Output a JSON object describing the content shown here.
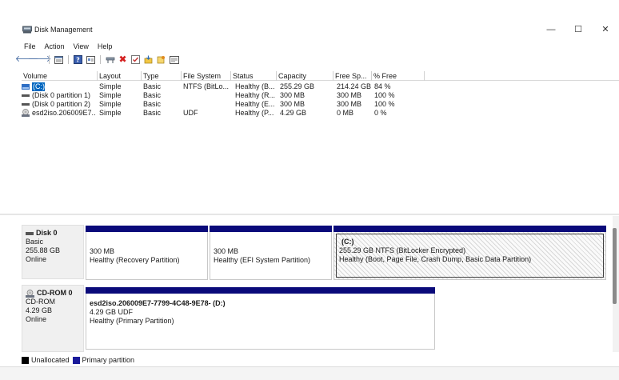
{
  "window": {
    "title": "Disk Management",
    "controls": {
      "minimize": "—",
      "maximize": "☐",
      "close": "✕"
    }
  },
  "menu": [
    "File",
    "Action",
    "View",
    "Help"
  ],
  "toolbar": {
    "icons": [
      "back-arrow-icon",
      "forward-arrow-icon",
      "list-view-icon",
      "help-icon",
      "properties-icon",
      "connect-icon",
      "delete-icon",
      "check-icon",
      "import-icon",
      "wizard-icon",
      "console-icon"
    ]
  },
  "volume_list": {
    "columns": [
      "Volume",
      "Layout",
      "Type",
      "File System",
      "Status",
      "Capacity",
      "Free Sp...",
      "% Free"
    ],
    "rows": [
      [
        "(C:)",
        "Simple",
        "Basic",
        "NTFS (BitLo...",
        "Healthy (B...",
        "255.29 GB",
        "214.24 GB",
        "84 %"
      ],
      [
        "(Disk 0 partition 1)",
        "Simple",
        "Basic",
        "",
        "Healthy (R...",
        "300 MB",
        "300 MB",
        "100 %"
      ],
      [
        "(Disk 0 partition 2)",
        "Simple",
        "Basic",
        "",
        "Healthy (E...",
        "300 MB",
        "300 MB",
        "100 %"
      ],
      [
        "esd2iso.206009E7...",
        "Simple",
        "Basic",
        "UDF",
        "Healthy (P...",
        "4.29 GB",
        "0 MB",
        "0 %"
      ]
    ]
  },
  "disks": [
    {
      "name": "Disk 0",
      "type": "Basic",
      "size": "255.88 GB",
      "status": "Online",
      "partitions": [
        {
          "title": "",
          "line1": "300 MB",
          "line2": "Healthy (Recovery Partition)"
        },
        {
          "title": "",
          "line1": "300 MB",
          "line2": "Healthy (EFI System Partition)"
        },
        {
          "title": "(C:)",
          "line1": "255.29 GB NTFS (BitLocker Encrypted)",
          "line2": "Healthy (Boot, Page File, Crash Dump, Basic Data Partition)"
        }
      ]
    },
    {
      "name": "CD-ROM 0",
      "type": "CD-ROM",
      "size": "4.29 GB",
      "status": "Online",
      "partitions": [
        {
          "title": "esd2iso.206009E7-7799-4C48-9E78-  (D:)",
          "line1": "4.29 GB UDF",
          "line2": "Healthy (Primary Partition)"
        }
      ]
    }
  ],
  "legend": [
    {
      "label": "Unallocated",
      "color": "#000000"
    },
    {
      "label": "Primary partition",
      "color": "#1a1a9a"
    }
  ],
  "colors": {
    "partition_bar": "#0a0a7a",
    "selected_volume": "#0067c0"
  }
}
